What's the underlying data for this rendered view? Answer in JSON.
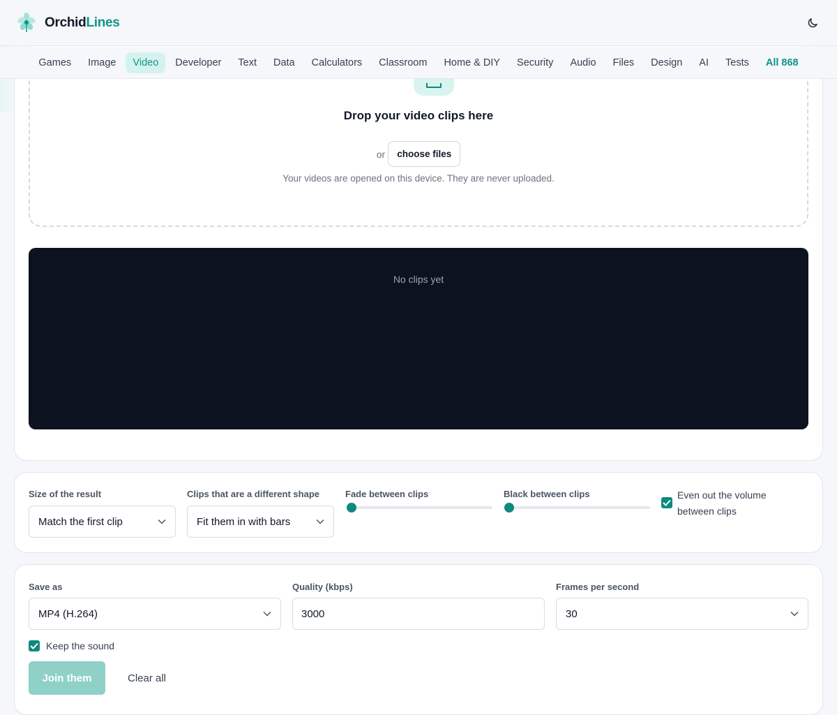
{
  "brand": {
    "name_a": "Orchid",
    "name_b": "Lines"
  },
  "nav": {
    "items": [
      "Games",
      "Image",
      "Video",
      "Developer",
      "Text",
      "Data",
      "Calculators",
      "Classroom",
      "Home & DIY",
      "Security",
      "Audio",
      "Files",
      "Design",
      "AI",
      "Tests"
    ],
    "all_label": "All 868",
    "active": "Video"
  },
  "dropzone": {
    "title": "Drop your video clips here",
    "or": "or",
    "choose_label": "choose files",
    "note": "Your videos are opened on this device. They are never uploaded."
  },
  "preview": {
    "empty_text": "No clips yet"
  },
  "options": {
    "size_label": "Size of the result",
    "size_value": "Match the first clip",
    "shape_label": "Clips that are a different shape",
    "shape_value": "Fit them in with bars",
    "fade_label": "Fade between clips",
    "fade_level": 0,
    "black_label": "Black between clips",
    "black_level": 0,
    "volume_label_1": "Even out the volume",
    "volume_label_2": "between clips",
    "volume_checked": true
  },
  "export": {
    "format_label": "Save as",
    "format_value": "MP4 (H.264)",
    "quality_label": "Quality (kbps)",
    "quality_value": "3000",
    "fps_label": "Frames per second",
    "fps_value": "30",
    "sound_label": "Keep the sound",
    "sound_checked": true,
    "join_label": "Join them",
    "clear_label": "Clear all"
  },
  "colors": {
    "accent": "#0f8a7e",
    "accent_light": "#d5f3ee",
    "preview_bg": "#0c1220"
  }
}
